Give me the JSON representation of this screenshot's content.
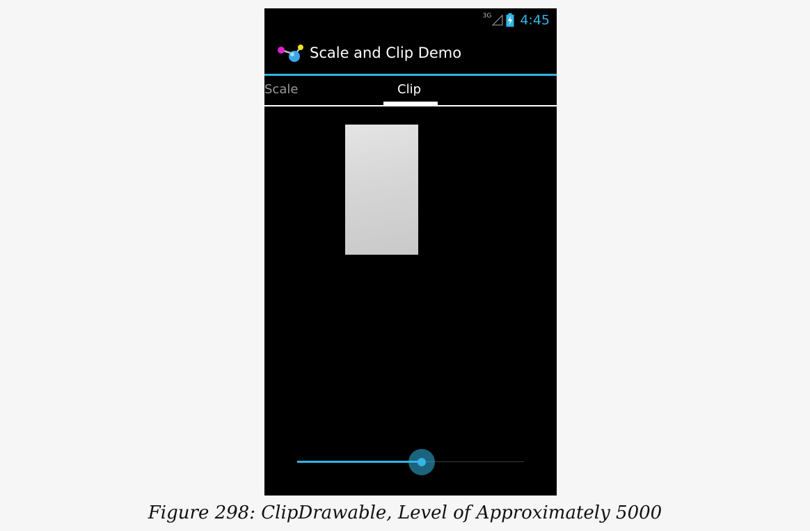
{
  "status_bar": {
    "network_type": "3G",
    "time": "4:45",
    "icons": [
      "signal-icon",
      "battery-charging-icon"
    ]
  },
  "action_bar": {
    "app_icon": "app-logo-icon",
    "title": "Scale and Clip Demo"
  },
  "tabs": [
    {
      "label": "Scale",
      "selected": false
    },
    {
      "label": "Clip",
      "selected": true
    }
  ],
  "seekbar": {
    "progress_fraction": 0.55
  },
  "colors": {
    "accent": "#33b5e5",
    "background": "#000000",
    "page": "#f6f6f6"
  },
  "caption": "Figure 298: ClipDrawable, Level of Approximately 5000"
}
